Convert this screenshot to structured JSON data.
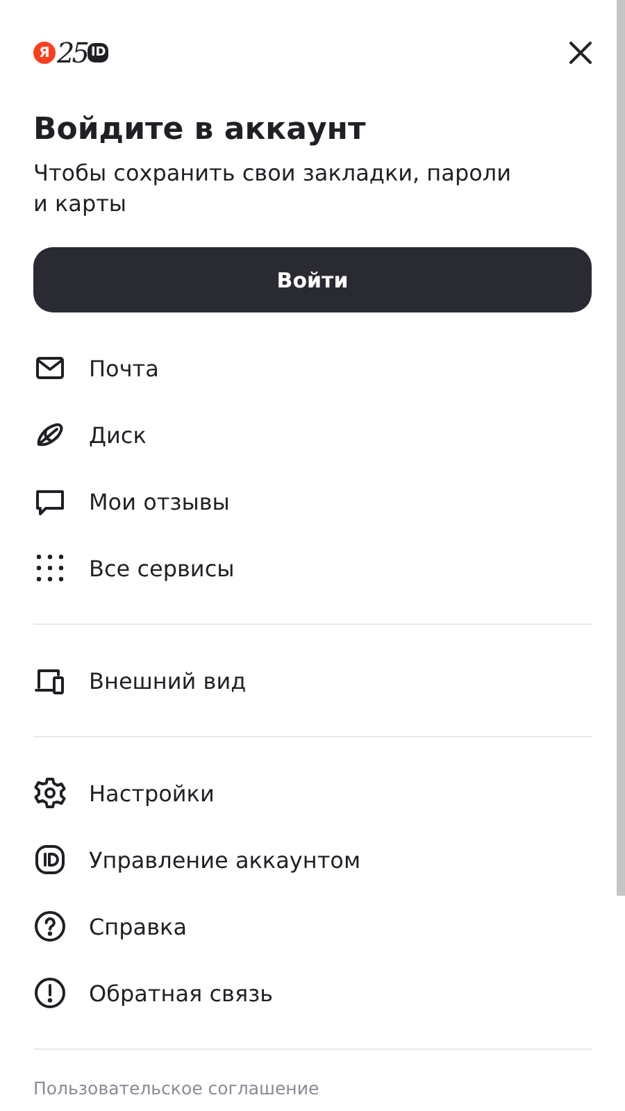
{
  "logo": {
    "letter": "Я",
    "number": "25",
    "badge": "ID"
  },
  "title": "Войдите в аккаунт",
  "subtitle": "Чтобы сохранить свои закладки, пароли и карты",
  "login_button": "Войти",
  "menu_groups": [
    {
      "items": [
        {
          "label": "Почта"
        },
        {
          "label": "Диск"
        },
        {
          "label": "Мои отзывы"
        },
        {
          "label": "Все сервисы"
        }
      ]
    },
    {
      "items": [
        {
          "label": "Внешний вид"
        }
      ]
    },
    {
      "items": [
        {
          "label": "Настройки"
        },
        {
          "label": "Управление аккаунтом"
        },
        {
          "label": "Справка"
        },
        {
          "label": "Обратная связь"
        }
      ]
    }
  ],
  "footer_link": "Пользовательское соглашение"
}
